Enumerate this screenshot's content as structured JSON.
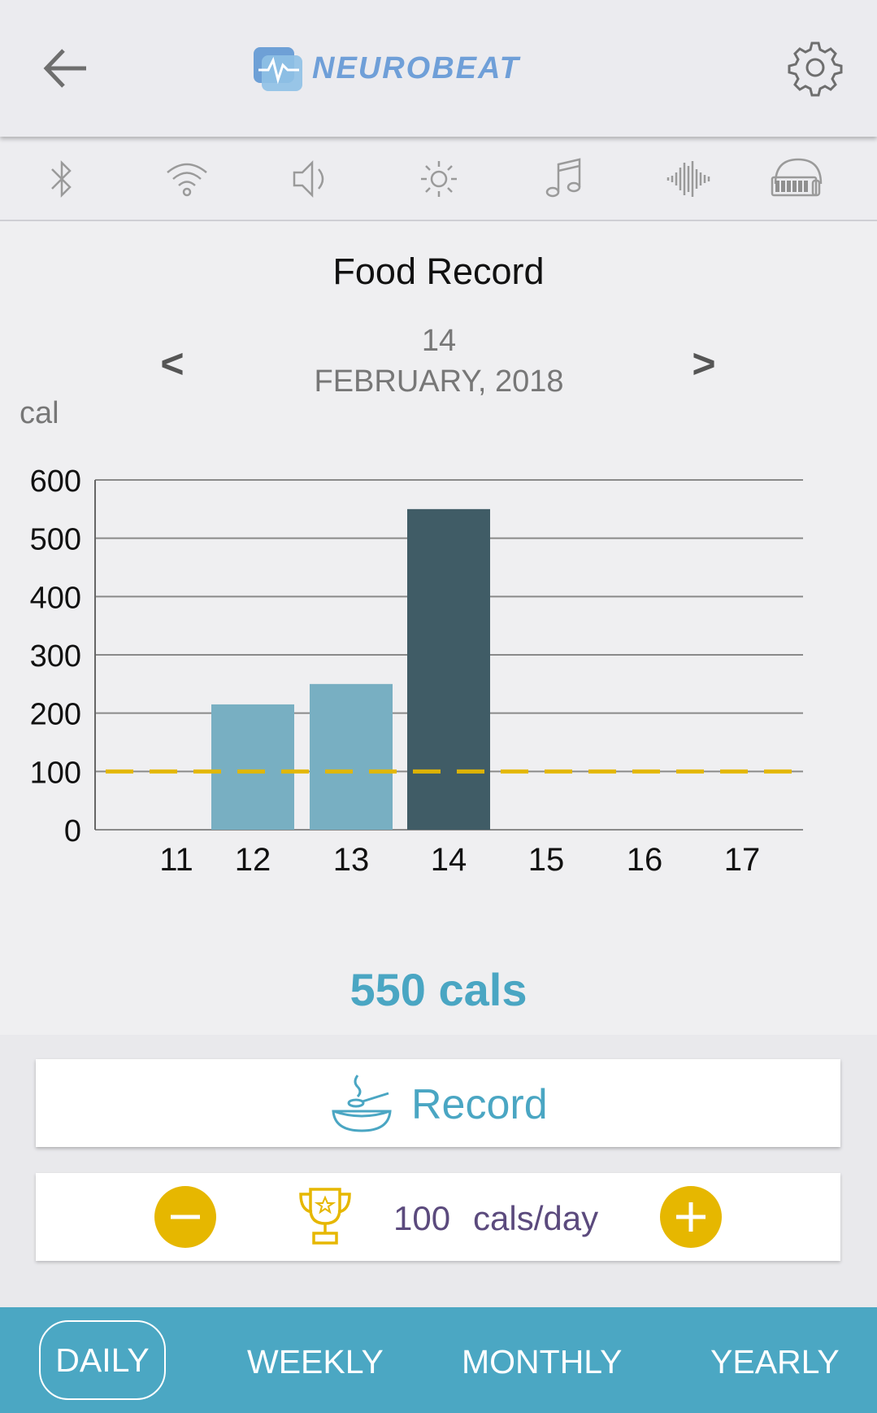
{
  "header": {
    "logo_text": "NEUROBEAT",
    "back_icon": "arrow-left-icon",
    "settings_icon": "gear-icon"
  },
  "status_icons": [
    "bluetooth-icon",
    "wifi-icon",
    "speaker-icon",
    "brightness-icon",
    "music-icon",
    "waveform-icon",
    "headphones-battery-icon"
  ],
  "page": {
    "title": "Food Record",
    "day": "14",
    "month_year": "FEBRUARY, 2018",
    "prev_label": "<",
    "next_label": ">",
    "total_label": "550 cals"
  },
  "chart_data": {
    "type": "bar",
    "ylabel": "cal",
    "ylim": [
      0,
      600
    ],
    "yticks": [
      "0",
      "100",
      "200",
      "300",
      "400",
      "500",
      "600"
    ],
    "categories": [
      "11",
      "12",
      "13",
      "14",
      "15",
      "16",
      "17"
    ],
    "values": [
      0,
      215,
      250,
      550,
      0,
      0,
      0
    ],
    "selected": "14",
    "goal_line": 100,
    "grid": true,
    "colors": {
      "bar": "#78afc2",
      "selected_bar": "#405c66",
      "goal": "#e6b800",
      "grid": "#8a8a8a"
    }
  },
  "actions": {
    "record_label": "Record",
    "bowl_icon": "bowl-icon"
  },
  "goal": {
    "value": "100",
    "unit": "cals/day",
    "minus_icon": "minus-icon",
    "plus_icon": "plus-icon",
    "trophy_icon": "trophy-icon"
  },
  "tabs": {
    "daily": "DAILY",
    "weekly": "WEEKLY",
    "monthly": "MONTHLY",
    "yearly": "YEARLY",
    "active": "DAILY"
  },
  "colors": {
    "accent": "#4aa6c3",
    "gold": "#e6b700",
    "goal_text": "#5b4a7d"
  }
}
